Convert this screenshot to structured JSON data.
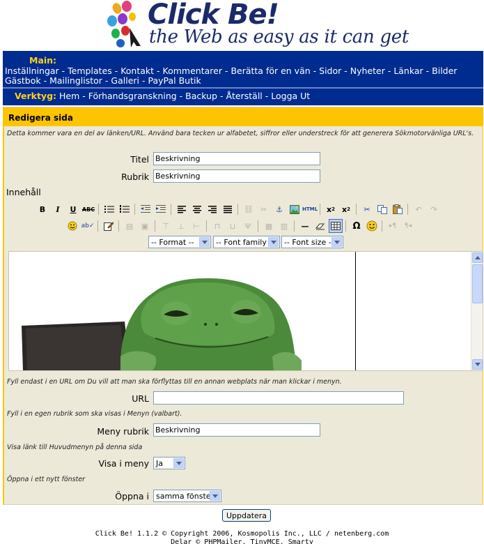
{
  "header": {
    "logo_title": "Click Be!",
    "tagline": "the Web as easy as it can get",
    "brand_color": "#1a2a6a"
  },
  "nav": {
    "main_label": "Main:",
    "main_row1": [
      "Inställningar",
      "Templates",
      "Kontakt",
      "Kommentarer",
      "Berätta för en vän",
      "Sidor",
      "Nyheter",
      "Länkar",
      "Bilder"
    ],
    "main_row2": [
      "Gästbok",
      "Mailinglistor",
      "Galleri",
      "PayPal Butik"
    ],
    "tools_label": "Verktyg:",
    "tools": [
      "Hem",
      "Förhandsgranskning",
      "Backup",
      "Återställ",
      "Logga Ut"
    ],
    "background_color": "#002b8f",
    "label_color": "#ffd21a"
  },
  "form": {
    "title": "Redigera sida",
    "hint_url_name": "Detta kommer vara en del av länken/URL. Använd bara tecken ur alfabetet, siffror eller understreck för att generera Sökmotorvänliga URL's.",
    "titel_label": "Titel",
    "titel_value": "Beskrivning",
    "rubrik_label": "Rubrik",
    "rubrik_value": "Beskrivning",
    "content_label": "Innehåll",
    "toolbar": {
      "format_select": "-- Format --",
      "font_family_select": "-- Font family --",
      "font_size_select": "-- Font size --"
    },
    "hint_url": "Fyll endast i en URL om Du vill att man ska förflyttas till en annan webplats när man klickar i menyn.",
    "url_label": "URL",
    "url_value": "",
    "hint_menu_title": "Fyll i en egen rubrik som ska visas i Menyn (valbart).",
    "menu_title_label": "Meny rubrik",
    "menu_title_value": "Beskrivning",
    "hint_show_menu": "Visa länk till Huvudmenyn på denna sida",
    "show_menu_label": "Visa i meny",
    "show_menu_value": "Ja",
    "hint_new_window": "Öppna i ett nytt fönster",
    "open_in_label": "Öppna i",
    "open_in_value": "samma fönster",
    "panel_bg": "#ece9d8",
    "title_bar_color": "#ffc400"
  },
  "update_button": "Uppdatera",
  "footer": {
    "line1": "Click Be! 1.1.2 © Copyright 2006, Kosmopolis Inc., LLC / netenberg.com",
    "line2": "Delar © PHPMailer, TinyMCE, Smarty"
  }
}
